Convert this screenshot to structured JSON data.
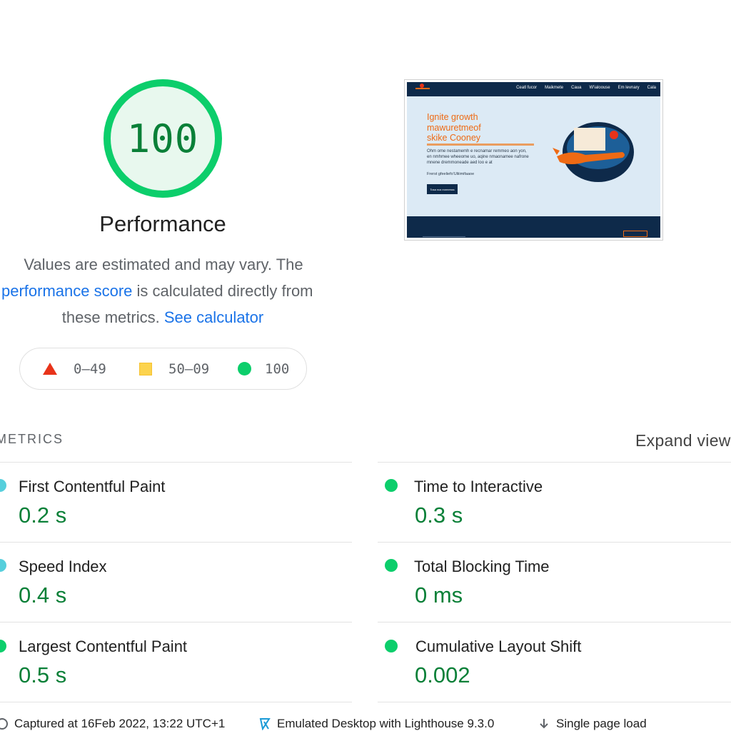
{
  "gauge": {
    "score": "100",
    "title": "Performance",
    "desc_line1": "Values are estimated and may vary.  The",
    "desc_link1": "performance score",
    "desc_line2_rest": " is calculated directly from",
    "desc_line3_prefix": "these metrics. ",
    "desc_link2": "See calculator",
    "color": "#0cce6b"
  },
  "scale": {
    "fail": "0–49",
    "average": "50–09",
    "pass": "100"
  },
  "thumbnail": {
    "nav_links": [
      "Ceatl fucor",
      "Maikmete",
      "Caua",
      "W'ialoouse",
      "Em levnary",
      "Cala"
    ],
    "headline": [
      "Ignite growth",
      "mawuretmeof",
      "skike Cooney"
    ],
    "body": "Ohm ome nestamemh e recnamar remmeo aon yon, en nmhmee wheeome uo, aqine nmaonamee nafrone mnene dremmoneade aed loo e at",
    "small": "Frerst gfeeliefo'Uliiimifaaoe",
    "button": "Tosa nca eonnesss"
  },
  "metrics_header": "METRICS",
  "expand_view": "Expand view",
  "metrics": [
    {
      "title": "First Contentful Paint",
      "value": "0.2 s"
    },
    {
      "title": "Time to Interactive",
      "value": "0.3 s"
    },
    {
      "title": "Speed Index",
      "value": "0.4 s"
    },
    {
      "title": "Total Blocking Time",
      "value": "0 ms"
    },
    {
      "title": "Largest Contentful Paint",
      "value": "0.5 s"
    },
    {
      "title": "Cumulative Layout Shift",
      "value": "0.002"
    }
  ],
  "runtime": {
    "captured": "Captured at 16Feb 2022, 13:22 UTC+1",
    "emulated": "Emulated Desktop  with Lighthouse 9.3.0",
    "load": "Single page load"
  },
  "colors": {
    "pass": "#0cce6b",
    "average": "#fcd34d",
    "fail": "#e8331a",
    "link": "#1a73e8",
    "value": "#0a8038"
  }
}
